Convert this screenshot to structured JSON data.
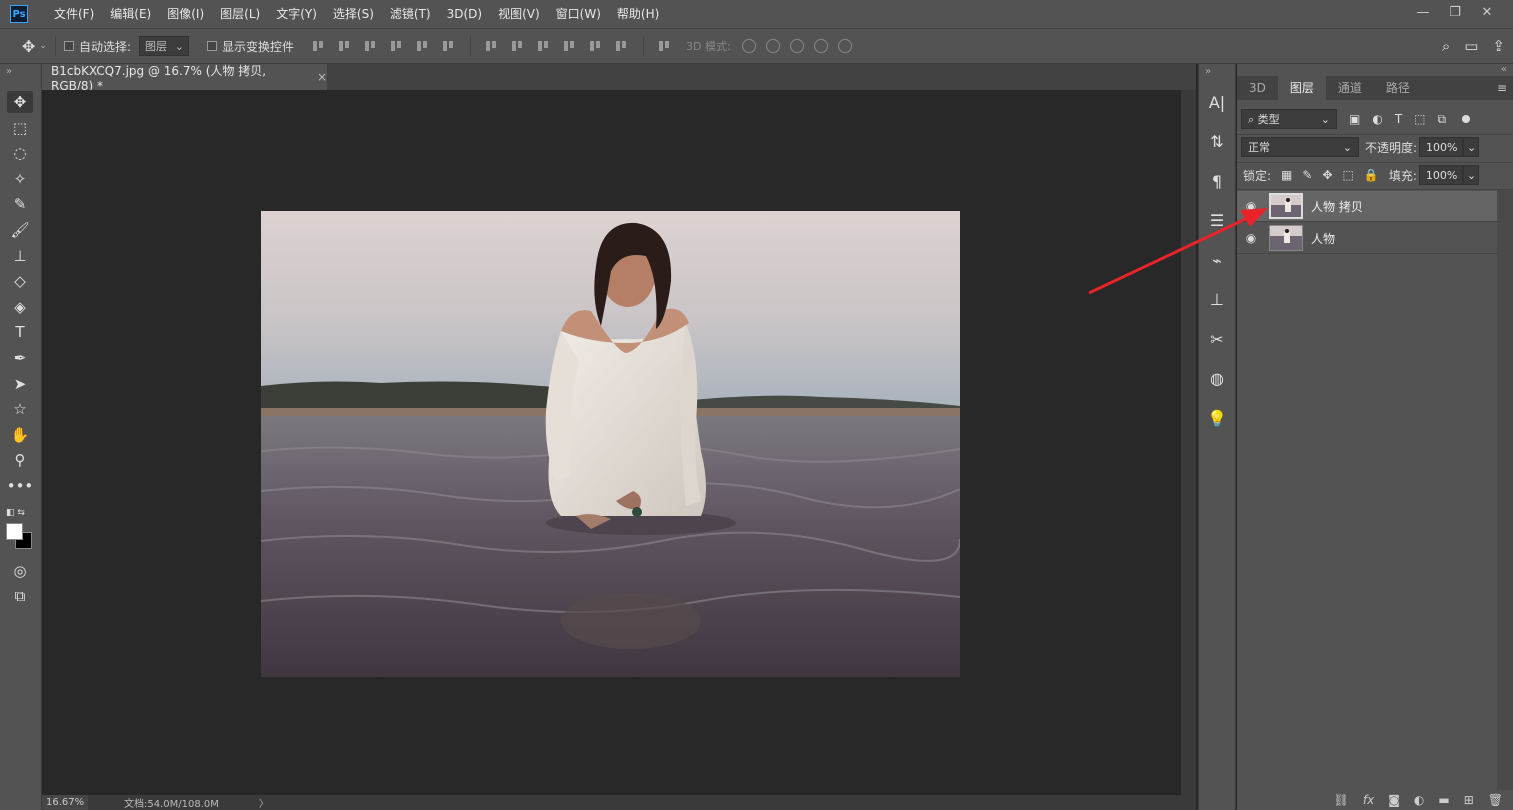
{
  "app": {
    "logo": "Ps",
    "menu": [
      "文件(F)",
      "编辑(E)",
      "图像(I)",
      "图层(L)",
      "文字(Y)",
      "选择(S)",
      "滤镜(T)",
      "3D(D)",
      "视图(V)",
      "窗口(W)",
      "帮助(H)"
    ],
    "window_controls": [
      "—",
      "❐",
      "✕"
    ]
  },
  "options": {
    "auto_select_label": "自动选择:",
    "auto_select_target": "图层",
    "show_transform_label": "显示变换控件",
    "mode_3d_label": "3D 模式:"
  },
  "document": {
    "tab_title": "B1cbKXCQ7.jpg @ 16.7% (人物 拷贝, RGB/8) *",
    "close_glyph": "×"
  },
  "status": {
    "zoom": "16.67%",
    "doc_size": "文档:54.0M/108.0M",
    "arrow": "〉"
  },
  "layers_panel": {
    "tabs": [
      "3D",
      "图层",
      "通道",
      "路径"
    ],
    "active_tab": "图层",
    "menu_glyph": "≡",
    "filter_kind": "类型",
    "blend_mode": "正常",
    "opacity_label": "不透明度:",
    "opacity_value": "100%",
    "lock_label": "锁定:",
    "fill_label": "填充:",
    "fill_value": "100%",
    "layers": [
      {
        "name": "人物 拷贝",
        "selected": true,
        "visible": true
      },
      {
        "name": "人物",
        "selected": false,
        "visible": true
      }
    ]
  },
  "colors": {
    "chrome": "#535353",
    "canvas_bg": "#282828",
    "annotation_arrow": "#e8232a"
  }
}
